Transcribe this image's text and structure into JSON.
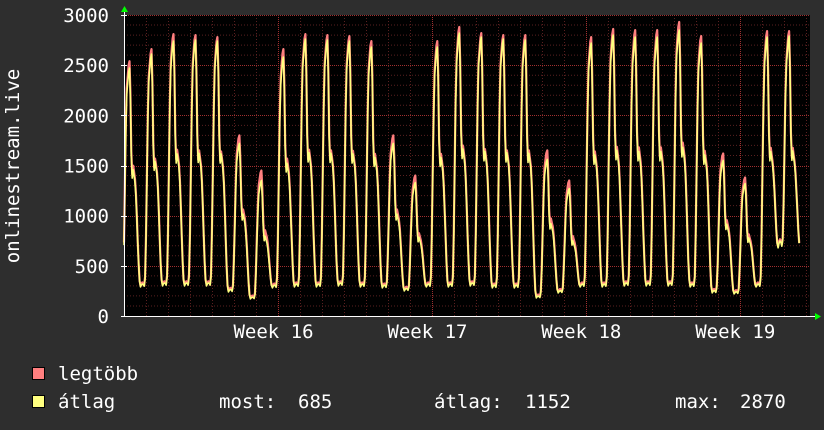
{
  "chart_data": {
    "type": "line",
    "ylabel": "onlinestream.live",
    "ylim": [
      0,
      3000
    ],
    "yticks": [
      0,
      500,
      1000,
      1500,
      2000,
      2500,
      3000
    ],
    "x_ticks": [
      {
        "label": "Week 16",
        "day": 7
      },
      {
        "label": "Week 17",
        "day": 14
      },
      {
        "label": "Week 18",
        "day": 21
      },
      {
        "label": "Week 19",
        "day": 28
      }
    ],
    "days_shown": 31.2,
    "background": "#000000",
    "grid": true,
    "colors": {
      "max": "#ff7f7f",
      "avg": "#ffff7f",
      "grid": "#a03030",
      "axis": "#ffffff",
      "arrow": "#00ff00"
    },
    "daily_peak_max": [
      2540,
      2660,
      2810,
      2800,
      2780,
      1800,
      1450,
      2660,
      2810,
      2800,
      2790,
      2740,
      1800,
      1400,
      2740,
      2880,
      2820,
      2800,
      2800,
      1650,
      1350,
      2780,
      2860,
      2850,
      2850,
      2930,
      2790,
      1620,
      1380,
      2840,
      2840
    ],
    "daily_peak_avg": [
      2470,
      2610,
      2740,
      2750,
      2740,
      1720,
      1350,
      2580,
      2760,
      2750,
      2740,
      2680,
      1720,
      1330,
      2680,
      2820,
      2780,
      2760,
      2750,
      1560,
      1270,
      2720,
      2800,
      2780,
      2780,
      2850,
      2720,
      1550,
      1320,
      2780,
      2790
    ],
    "daily_low": [
      240,
      290,
      300,
      300,
      300,
      240,
      170,
      280,
      290,
      290,
      300,
      290,
      280,
      250,
      290,
      290,
      300,
      280,
      280,
      180,
      230,
      290,
      290,
      300,
      300,
      300,
      290,
      230,
      220,
      290,
      680
    ],
    "series": [
      {
        "name": "legtöbb",
        "role": "max"
      },
      {
        "name": "átlag",
        "role": "avg"
      }
    ],
    "stats": {
      "most_label": "most:",
      "most": "685",
      "atlag_label": "átlag:",
      "atlag": "1152",
      "max_label": "max:",
      "max": "2870"
    }
  }
}
